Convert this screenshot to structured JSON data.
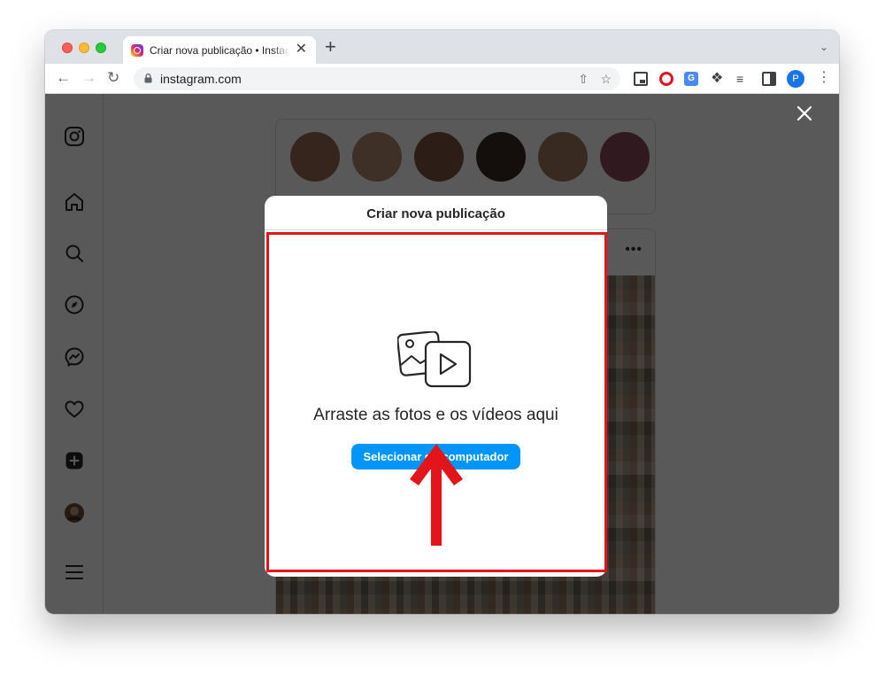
{
  "browser": {
    "tab_title": "Criar nova publicação • Instagram",
    "tab_close": "✕",
    "new_tab": "+",
    "url": "instagram.com",
    "profile_initial": "P"
  },
  "sidebar": {
    "items": [
      "instagram-logo-icon",
      "home-icon",
      "search-icon",
      "explore-icon",
      "messenger-icon",
      "heart-icon",
      "create-icon",
      "profile-avatar",
      "menu-icon"
    ]
  },
  "modal": {
    "title": "Criar nova publicação",
    "drop_text": "Arraste as fotos e os vídeos aqui",
    "select_button": "Selecionar do computador"
  },
  "colors": {
    "instagram_blue": "#0095f6",
    "highlight_red": "#e3141a",
    "overlay": "rgba(0,0,0,0.65)"
  }
}
